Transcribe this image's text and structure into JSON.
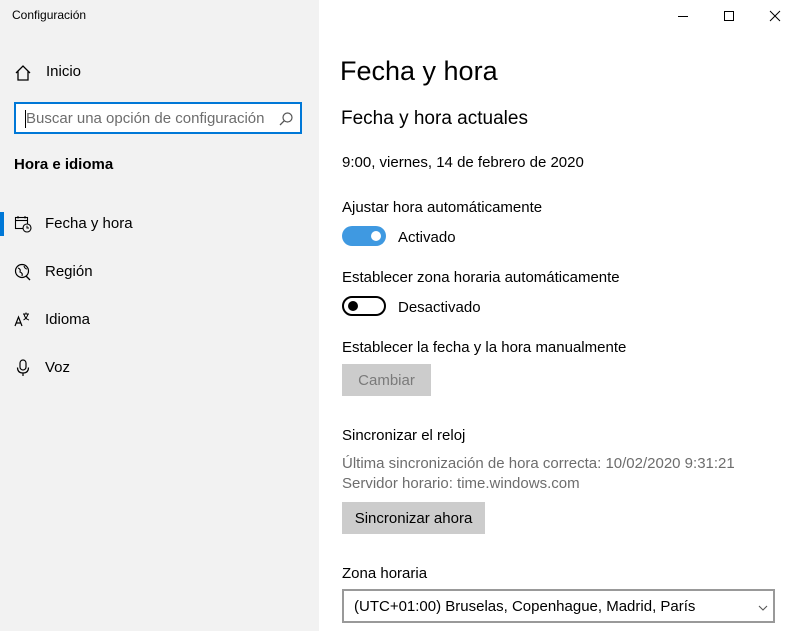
{
  "window": {
    "title": "Configuración"
  },
  "sidebar": {
    "home_label": "Inicio",
    "search_placeholder": "Buscar una opción de configuración",
    "section_title": "Hora e idioma",
    "items": [
      {
        "label": "Fecha y hora",
        "icon": "calendar-clock-icon",
        "selected": true
      },
      {
        "label": "Región",
        "icon": "globe-icon",
        "selected": false
      },
      {
        "label": "Idioma",
        "icon": "language-icon",
        "selected": false
      },
      {
        "label": "Voz",
        "icon": "microphone-icon",
        "selected": false
      }
    ]
  },
  "main": {
    "title": "Fecha y hora",
    "current_heading": "Fecha y hora actuales",
    "current_datetime": "9:00, viernes, 14 de febrero de 2020",
    "auto_time": {
      "label": "Ajustar hora automáticamente",
      "state_label": "Activado",
      "on": true
    },
    "auto_timezone": {
      "label": "Establecer zona horaria automáticamente",
      "state_label": "Desactivado",
      "on": false
    },
    "manual": {
      "label": "Establecer la fecha y la hora manualmente",
      "button": "Cambiar"
    },
    "sync": {
      "heading": "Sincronizar el reloj",
      "last_sync": "Última sincronización de hora correcta: 10/02/2020 9:31:21",
      "server": "Servidor horario: time.windows.com",
      "button": "Sincronizar ahora"
    },
    "timezone": {
      "label": "Zona horaria",
      "value": "(UTC+01:00) Bruselas, Copenhague, Madrid, París"
    }
  },
  "colors": {
    "accent": "#0078d7",
    "sidebar_bg": "#f2f2f2",
    "muted_text": "#6d6d6d",
    "button_bg": "#cccccc"
  }
}
